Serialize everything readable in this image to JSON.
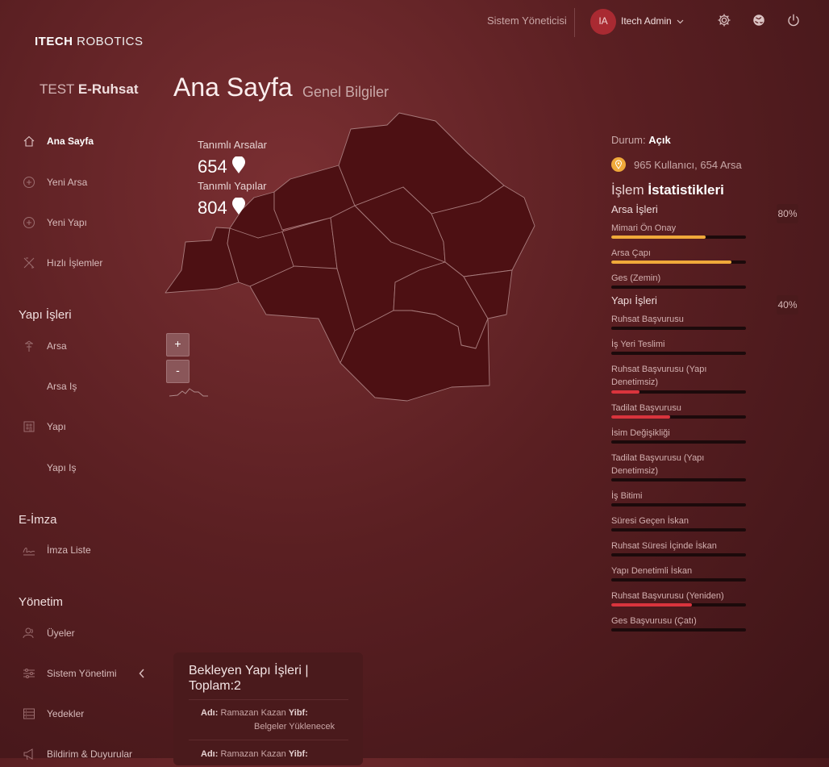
{
  "header": {
    "brand_bold": "ITECH",
    "brand_light": "ROBOTICS",
    "role": "Sistem Yöneticisi",
    "avatar_initials": "IA",
    "user_name": "Itech Admin"
  },
  "sidebar": {
    "system_prefix": "TEST",
    "system_name": "E-Ruhsat",
    "items_top": [
      {
        "label": "Ana Sayfa"
      },
      {
        "label": "Yeni Arsa"
      },
      {
        "label": "Yeni Yapı"
      },
      {
        "label": "Hızlı İşlemler"
      }
    ],
    "section_yapi": "Yapı İşleri",
    "items_yapi": [
      {
        "label": "Arsa"
      },
      {
        "label": "Arsa Iş"
      },
      {
        "label": "Yapı"
      },
      {
        "label": "Yapı Iş"
      }
    ],
    "section_eimza": "E-İmza",
    "items_eimza": [
      {
        "label": "İmza Liste"
      }
    ],
    "section_yonetim": "Yönetim",
    "items_yonetim": [
      {
        "label": "Üyeler"
      },
      {
        "label": "Sistem Yönetimi"
      },
      {
        "label": "Yedekler"
      },
      {
        "label": "Bildirim & Duyurular"
      }
    ]
  },
  "main": {
    "title": "Ana Sayfa",
    "subtitle": "Genel Bilgiler",
    "map": {
      "arsa_label": "Tanımlı Arsalar",
      "arsa_count": "654",
      "yapi_label": "Tanımlı Yapılar",
      "yapi_count": "804",
      "zoom_in": "+",
      "zoom_out": "-"
    }
  },
  "stats": {
    "status_label": "Durum:",
    "status_value": "Açık",
    "summary": "965 Kullanıcı, 654 Arsa",
    "title_light": "İşlem",
    "title_bold": "İstatistikleri",
    "groups": [
      {
        "label": "Arsa İşleri",
        "pct": "80%",
        "bars": [
          {
            "label": "Mimari Ön Onay",
            "value": 0.7,
            "color": "#f0a93a"
          },
          {
            "label": "Arsa Çapı",
            "value": 0.89,
            "color": "#f0a93a"
          },
          {
            "label": "Ges (Zemin)",
            "value": 0,
            "color": "#f0a93a"
          }
        ]
      },
      {
        "label": "Yapı İşleri",
        "pct": "40%",
        "bars": [
          {
            "label": "Ruhsat Başvurusu",
            "value": 0,
            "color": "#d9343d"
          },
          {
            "label": "İş Yeri Teslimi",
            "value": 0,
            "color": "#d9343d"
          },
          {
            "label": "Ruhsat Başvurusu (Yapı Denetimsiz)",
            "value": 0.21,
            "color": "#d9343d"
          },
          {
            "label": "Tadilat Başvurusu",
            "value": 0.44,
            "color": "#d9343d"
          },
          {
            "label": "İsim Değişikliği",
            "value": 0,
            "color": "#d9343d"
          },
          {
            "label": "Tadilat Başvurusu (Yapı Denetimsiz)",
            "value": 0,
            "color": "#d9343d"
          },
          {
            "label": "İş Bitimi",
            "value": 0,
            "color": "#d9343d"
          },
          {
            "label": "Süresi Geçen İskan",
            "value": 0,
            "color": "#d9343d"
          },
          {
            "label": "Ruhsat Süresi İçinde İskan",
            "value": 0,
            "color": "#d9343d"
          },
          {
            "label": "Yapı Denetimli İskan",
            "value": 0,
            "color": "#d9343d"
          },
          {
            "label": "Ruhsat Başvurusu (Yeniden)",
            "value": 0.6,
            "color": "#d9343d"
          },
          {
            "label": "Ges Başvurusu (Çatı)",
            "value": 0,
            "color": "#d9343d"
          }
        ]
      }
    ]
  },
  "pending": {
    "title": "Bekleyen Yapı İşleri | Toplam:2",
    "rows": [
      {
        "ad_label": "Adı:",
        "ad": "Ramazan Kazan",
        "yibf_label": "Yibf:",
        "status": "Belgeler Yüklenecek"
      },
      {
        "ad_label": "Adı:",
        "ad": "Ramazan Kazan",
        "yibf_label": "Yibf:",
        "status": ""
      }
    ]
  },
  "colors": {
    "accent": "#a92a32",
    "orange": "#f0a93a",
    "red": "#d9343d",
    "map_fill": "#4d1013"
  }
}
